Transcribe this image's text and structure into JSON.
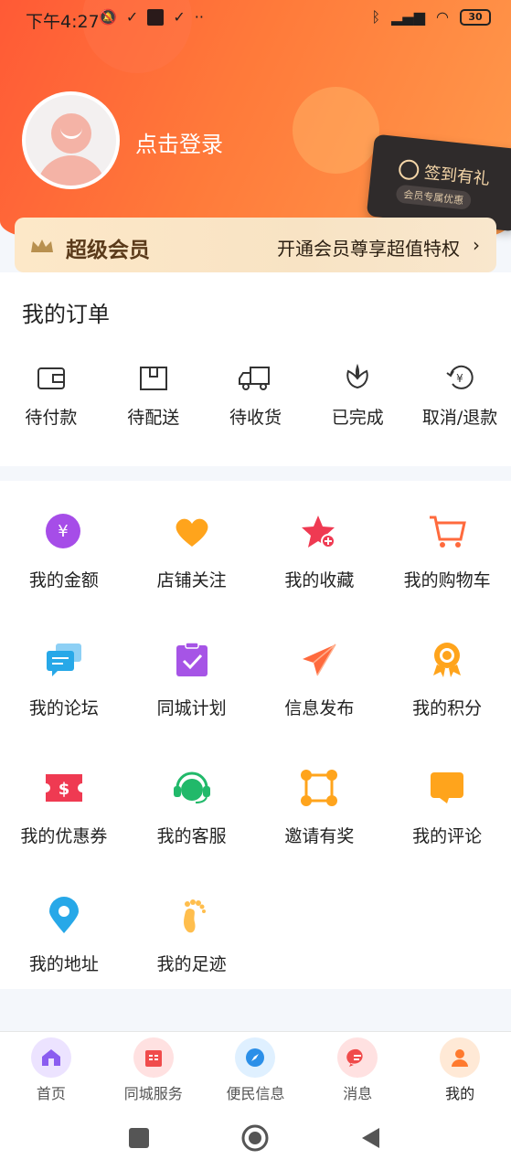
{
  "status_bar": {
    "time": "下午4:27",
    "battery": "30"
  },
  "profile": {
    "login_label": "点击登录"
  },
  "signin_card": {
    "title": "签到有礼",
    "subtitle": "会员专属优惠"
  },
  "vip": {
    "label": "超级会员",
    "promo": "开通会员尊享超值特权"
  },
  "orders": {
    "title": "我的订单",
    "items": [
      {
        "label": "待付款",
        "icon": "wallet-icon"
      },
      {
        "label": "待配送",
        "icon": "package-icon"
      },
      {
        "label": "待收货",
        "icon": "truck-icon"
      },
      {
        "label": "已完成",
        "icon": "flower-icon"
      },
      {
        "label": "取消/退款",
        "icon": "refund-icon"
      }
    ]
  },
  "services": [
    {
      "label": "我的金额",
      "icon": "yen-icon",
      "color": "#a64de8"
    },
    {
      "label": "店铺关注",
      "icon": "heart-icon",
      "color": "#ffa41c"
    },
    {
      "label": "我的收藏",
      "icon": "star-icon",
      "color": "#ef3a52"
    },
    {
      "label": "我的购物车",
      "icon": "cart-icon",
      "color": "#ff6a3d"
    },
    {
      "label": "我的论坛",
      "icon": "chat-icon",
      "color": "#27a8e8"
    },
    {
      "label": "同城计划",
      "icon": "clipboard-icon",
      "color": "#a654e6"
    },
    {
      "label": "信息发布",
      "icon": "paper-plane-icon",
      "color": "#ff6a3d"
    },
    {
      "label": "我的积分",
      "icon": "medal-icon",
      "color": "#ffa41c"
    },
    {
      "label": "我的优惠券",
      "icon": "coupon-icon",
      "color": "#ef3a52"
    },
    {
      "label": "我的客服",
      "icon": "headset-icon",
      "color": "#21b96a"
    },
    {
      "label": "邀请有奖",
      "icon": "network-icon",
      "color": "#ffa41c"
    },
    {
      "label": "我的评论",
      "icon": "comment-icon",
      "color": "#ffa41c"
    },
    {
      "label": "我的地址",
      "icon": "location-icon",
      "color": "#27a8e8"
    },
    {
      "label": "我的足迹",
      "icon": "footprint-icon",
      "color": "#ffbe4d"
    }
  ],
  "tabbar": [
    {
      "label": "首页",
      "icon": "home-icon",
      "color": "#8a5cf0",
      "bubble": "#ece3ff"
    },
    {
      "label": "同城服务",
      "icon": "building-icon",
      "color": "#f04b4b",
      "bubble": "#ffe1e1"
    },
    {
      "label": "便民信息",
      "icon": "compass-icon",
      "color": "#2b8fe8",
      "bubble": "#dff0ff"
    },
    {
      "label": "消息",
      "icon": "message-icon",
      "color": "#f04b4b",
      "bubble": "#ffe1e1"
    },
    {
      "label": "我的",
      "icon": "user-icon",
      "color": "#ff7a2e",
      "bubble": "#ffe9d6"
    }
  ]
}
